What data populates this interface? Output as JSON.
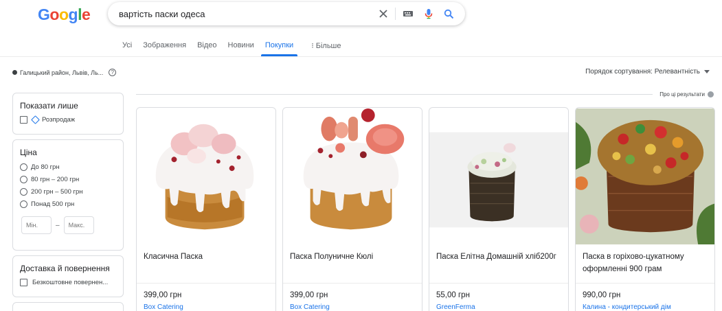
{
  "logo": {
    "letters": [
      "G",
      "o",
      "o",
      "g",
      "l",
      "e"
    ]
  },
  "search": {
    "value": "вартість паски одеса"
  },
  "tabs": [
    {
      "label": "Усі",
      "active": false
    },
    {
      "label": "Зображення",
      "active": false
    },
    {
      "label": "Відео",
      "active": false
    },
    {
      "label": "Новини",
      "active": false
    },
    {
      "label": "Покупки",
      "active": true
    },
    {
      "label": "⁝ Більше",
      "active": false
    }
  ],
  "location": {
    "text": "Галицький район, Львів, Ль...",
    "help": "?"
  },
  "sort": {
    "label": "Порядок сортування: Релевантність"
  },
  "about": {
    "label": "Про ці результати"
  },
  "filters": {
    "show_only": {
      "title": "Показати лише",
      "option": "Розпродаж"
    },
    "price": {
      "title": "Ціна",
      "options": [
        "До 80 грн",
        "80 грн – 200 грн",
        "200 грн – 500 грн",
        "Понад 500 грн"
      ],
      "min_placeholder": "Мін. ",
      "max_placeholder": "Макс.",
      "dash": "–"
    },
    "delivery": {
      "title": "Доставка й повернення",
      "option": "Безкоштовне повернен..."
    }
  },
  "products": [
    {
      "title": "Класична Паска",
      "price": "399,00 грн",
      "store": "Box Catering"
    },
    {
      "title": "Паска Полуничне Кюлі",
      "price": "399,00 грн",
      "store": "Box Catering"
    },
    {
      "title": "Паска Елітна Домашній хліб200г",
      "price": "55,00 грн",
      "store": "GreenFerma"
    },
    {
      "title": "Паска в горіхово-цукатному оформленні 900 грам",
      "price": "990,00 грн",
      "store": "Калина - кондитерський дім"
    }
  ],
  "colors": {
    "accent": "#1a73e8",
    "border": "#dadce0",
    "text": "#202124",
    "muted": "#5f6368"
  },
  "icons": [
    "clear-icon",
    "keyboard-icon",
    "microphone-icon",
    "search-icon",
    "help-icon",
    "tag-icon",
    "caret-down-icon",
    "info-icon"
  ]
}
